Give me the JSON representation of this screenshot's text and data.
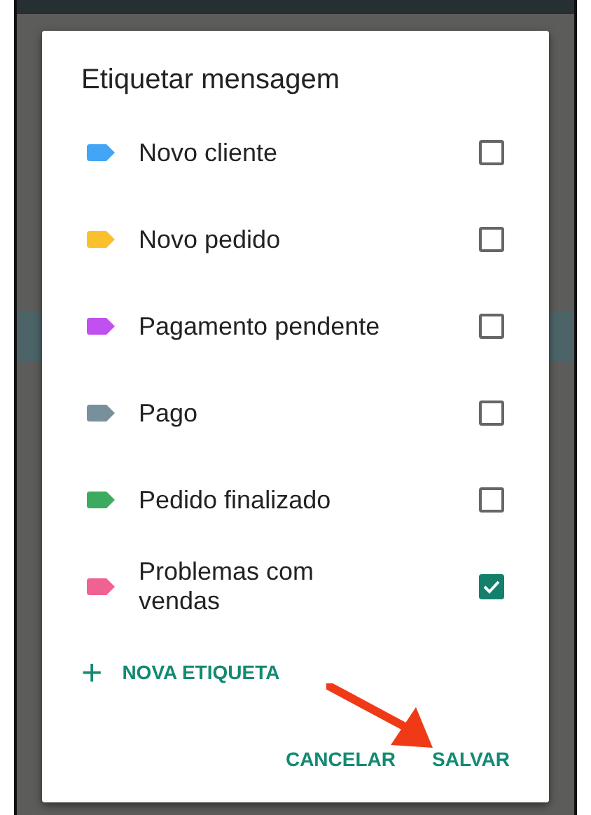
{
  "dialog": {
    "title": "Etiquetar mensagem",
    "labels": [
      {
        "name": "Novo cliente",
        "color": "#42a5f5",
        "checked": false
      },
      {
        "name": "Novo pedido",
        "color": "#fbc02d",
        "checked": false
      },
      {
        "name": "Pagamento pendente",
        "color": "#c150f0",
        "checked": false
      },
      {
        "name": "Pago",
        "color": "#78909c",
        "checked": false
      },
      {
        "name": "Pedido finalizado",
        "color": "#3dab5f",
        "checked": false
      },
      {
        "name": "Problemas com vendas",
        "color": "#f06292",
        "checked": true
      }
    ],
    "add_button": {
      "icon": "+",
      "label": "NOVA ETIQUETA"
    },
    "buttons": [
      "CANCELAR",
      "SALVAR"
    ]
  }
}
